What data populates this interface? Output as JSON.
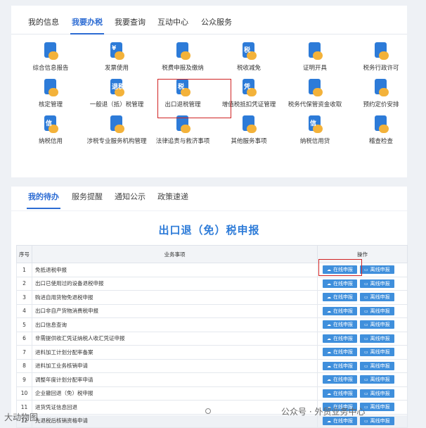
{
  "top_tabs": [
    "我的信息",
    "我要办税",
    "我要查询",
    "互动中心",
    "公众服务"
  ],
  "services": [
    {
      "label": "综合信息报告",
      "icon": "report-icon",
      "color": "#2d7bd8",
      "glyph": ""
    },
    {
      "label": "发票使用",
      "icon": "invoice-icon",
      "color": "#2d7bd8",
      "glyph": "¥"
    },
    {
      "label": "税费申报及缴纳",
      "icon": "tax-declare-icon",
      "color": "#2d7bd8",
      "glyph": ""
    },
    {
      "label": "税收减免",
      "icon": "tax-reduction-icon",
      "color": "#2d7bd8",
      "glyph": "税"
    },
    {
      "label": "证明开具",
      "icon": "certificate-icon",
      "color": "#2d7bd8",
      "glyph": ""
    },
    {
      "label": "税务行政许可",
      "icon": "permit-icon",
      "color": "#2d7bd8",
      "glyph": ""
    },
    {
      "label": "核定管理",
      "icon": "approval-icon",
      "color": "#2d7bd8",
      "glyph": ""
    },
    {
      "label": "一般退（抵）税管理",
      "icon": "refund-icon",
      "color": "#2d7bd8",
      "glyph": "退税"
    },
    {
      "label": "出口退税管理",
      "icon": "export-refund-icon",
      "color": "#2d7bd8",
      "glyph": "税"
    },
    {
      "label": "增值税抵扣凭证管理",
      "icon": "vat-voucher-icon",
      "color": "#2d7bd8",
      "glyph": "凭"
    },
    {
      "label": "税务代保管资金收取",
      "icon": "custody-fund-icon",
      "color": "#2d7bd8",
      "glyph": ""
    },
    {
      "label": "预约定价安排",
      "icon": "calendar-icon",
      "color": "#2d7bd8",
      "glyph": ""
    },
    {
      "label": "纳税信用",
      "icon": "credit-icon",
      "color": "#2d7bd8",
      "glyph": "信"
    },
    {
      "label": "涉税专业服务机构管理",
      "icon": "agency-icon",
      "color": "#2d7bd8",
      "glyph": ""
    },
    {
      "label": "法律追责与救济事项",
      "icon": "gavel-icon",
      "color": "#2d7bd8",
      "glyph": ""
    },
    {
      "label": "其他服务事项",
      "icon": "heart-hand-icon",
      "color": "#2d7bd8",
      "glyph": ""
    },
    {
      "label": "纳税信用贷",
      "icon": "credit-loan-icon",
      "color": "#2d7bd8",
      "glyph": "信"
    },
    {
      "label": "稽查检查",
      "icon": "search-icon",
      "color": "#2d7bd8",
      "glyph": ""
    }
  ],
  "sub_tabs": [
    "我的待办",
    "服务提醒",
    "通知公示",
    "政策速递"
  ],
  "page_title": "出口退（免）税申报",
  "table": {
    "headers": [
      "序号",
      "业务事项",
      "操作"
    ],
    "online_label": "在线申报",
    "offline_label": "离线申报",
    "rows": [
      {
        "no": "1",
        "item": "免抵退税申报"
      },
      {
        "no": "2",
        "item": "出口已使用过的设备退税申报"
      },
      {
        "no": "3",
        "item": "购进自用货物免退税申报"
      },
      {
        "no": "4",
        "item": "出口非自产货物消费税申报"
      },
      {
        "no": "5",
        "item": "出口信息查询"
      },
      {
        "no": "6",
        "item": "非需提供收汇凭证纳税人收汇凭证申报"
      },
      {
        "no": "7",
        "item": "进料加工计划分配率备案"
      },
      {
        "no": "8",
        "item": "进料加工业务核销申请"
      },
      {
        "no": "9",
        "item": "调整年度计划分配率申请"
      },
      {
        "no": "10",
        "item": "企业撤回退（免）税申报"
      },
      {
        "no": "11",
        "item": "进货凭证信息回退"
      },
      {
        "no": "12",
        "item": "先退税后核销资格申请"
      }
    ]
  },
  "watermark_left": "大动物图",
  "watermark_right": "公众号 · 外贸业务中心"
}
